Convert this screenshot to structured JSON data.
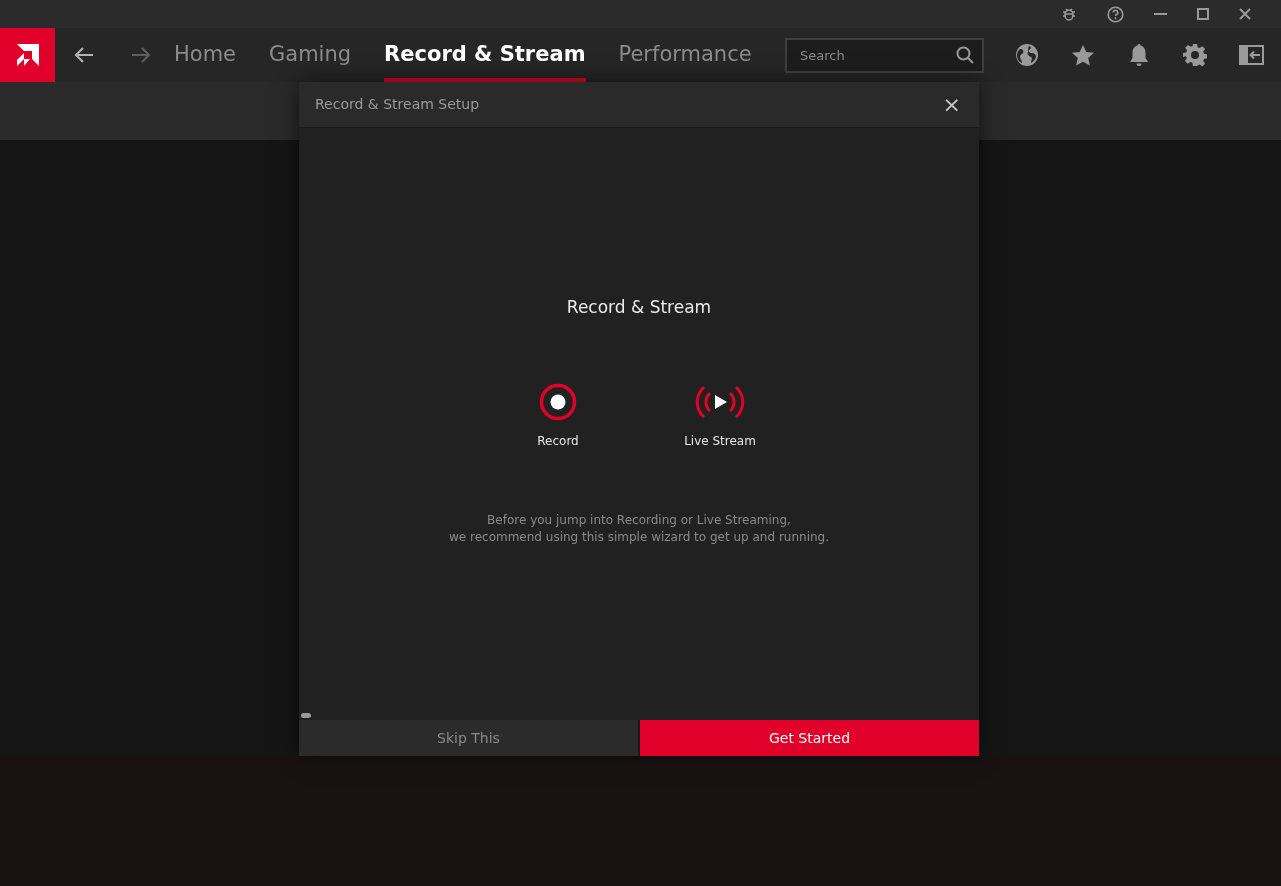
{
  "nav": {
    "tabs": [
      {
        "label": "Home",
        "selected": false
      },
      {
        "label": "Gaming",
        "selected": false
      },
      {
        "label": "Record & Stream",
        "selected": true
      },
      {
        "label": "Performance",
        "selected": false
      }
    ],
    "back_enabled": true,
    "forward_enabled": false,
    "search": {
      "placeholder": "Search"
    }
  },
  "dialog": {
    "title": "Record & Stream Setup",
    "close": "×",
    "heading": "Record & Stream",
    "options": [
      {
        "kind": "record",
        "label": "Record"
      },
      {
        "kind": "stream",
        "label": "Live Stream"
      }
    ],
    "description": [
      "Before you jump into Recording or Live Streaming,",
      "we recommend using this simple wizard to get up and running."
    ],
    "buttons": [
      {
        "label": "Skip This",
        "primary": false
      },
      {
        "label": "Get Started",
        "primary": true
      }
    ]
  }
}
